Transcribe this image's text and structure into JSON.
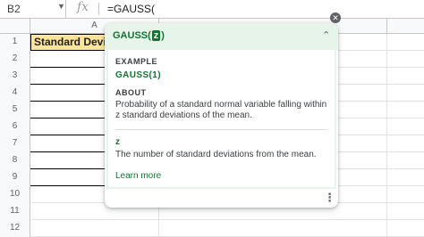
{
  "name_box": {
    "value": "B2"
  },
  "formula_bar": {
    "fx_label": "fx",
    "value": "=GAUSS("
  },
  "columns": {
    "a": "A"
  },
  "rows": [
    "1",
    "2",
    "3",
    "4",
    "5",
    "6",
    "7",
    "8",
    "9",
    "10",
    "11",
    "12"
  ],
  "cell_a1": "Standard Deviati",
  "help": {
    "function_name": "GAUSS(",
    "arg": "z",
    "close_paren": ")",
    "example_label": "EXAMPLE",
    "example": "GAUSS(1)",
    "about_label": "ABOUT",
    "about": "Probability of a standard normal variable falling within z standard deviations of the mean.",
    "param_name": "z",
    "param_desc": "The number of standard deviations from the mean.",
    "learn_more": "Learn more"
  },
  "colors": {
    "accent": "#137333",
    "header_fill": "#ffe599",
    "popup_tint": "#e6f4ea"
  }
}
